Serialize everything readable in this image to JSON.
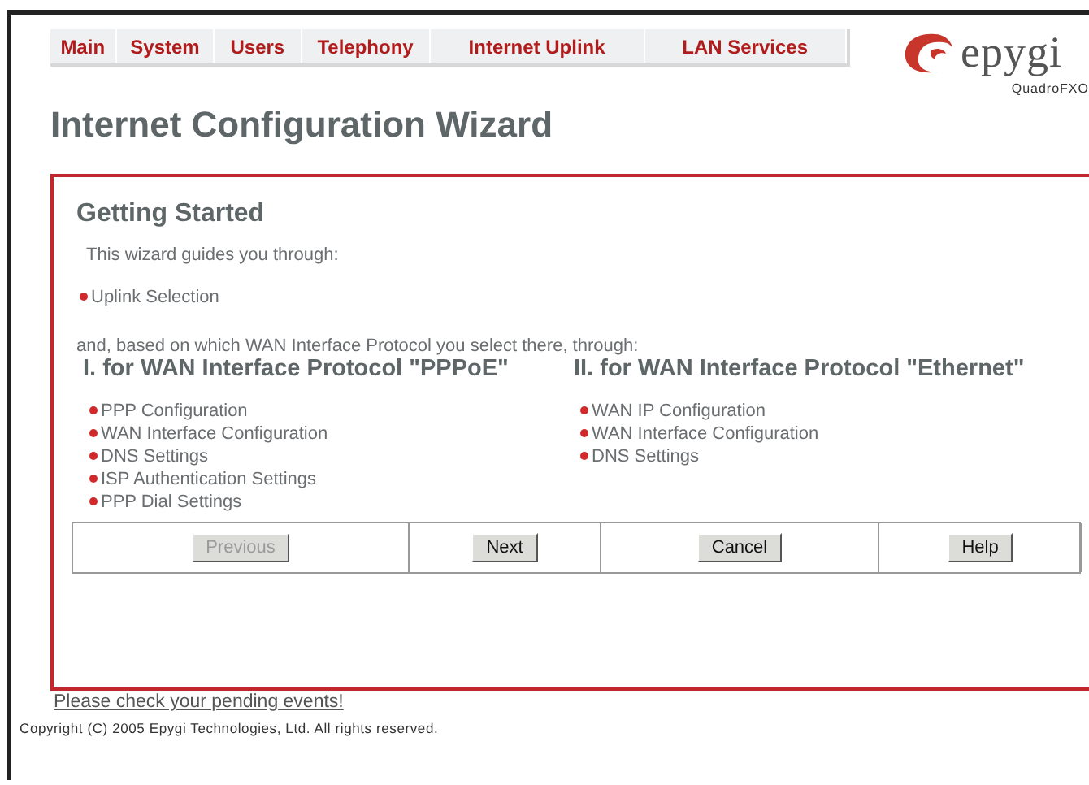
{
  "nav": [
    {
      "label": "Main"
    },
    {
      "label": "System"
    },
    {
      "label": "Users"
    },
    {
      "label": "Telephony"
    },
    {
      "label": "Internet Uplink"
    },
    {
      "label": "LAN Services"
    }
  ],
  "logo": {
    "word": "epygi",
    "model": "QuadroFXO"
  },
  "title": "Internet Configuration Wizard",
  "panel": {
    "heading": "Getting Started",
    "intro": "This wizard guides you through:",
    "first_steps": [
      "Uplink Selection"
    ],
    "bridge": "and, based on which WAN Interface Protocol you select there, through:",
    "columns": [
      {
        "heading": "I. for WAN Interface Protocol \"PPPoE\"",
        "steps": [
          "PPP Configuration",
          "WAN Interface Configuration",
          "DNS Settings",
          "ISP Authentication Settings",
          "PPP Dial Settings"
        ]
      },
      {
        "heading": "II. for WAN Interface Protocol \"Ethernet\"",
        "steps": [
          "WAN IP Configuration",
          "WAN Interface Configuration",
          "DNS Settings"
        ]
      }
    ],
    "buttons": [
      {
        "label": "Previous",
        "disabled": true
      },
      {
        "label": "Next",
        "disabled": false
      },
      {
        "label": "Cancel",
        "disabled": false
      },
      {
        "label": "Help",
        "disabled": false
      }
    ]
  },
  "events_link": "Please check your pending events!",
  "copyright": "Copyright (C) 2005 Epygi Technologies, Ltd. All rights reserved."
}
